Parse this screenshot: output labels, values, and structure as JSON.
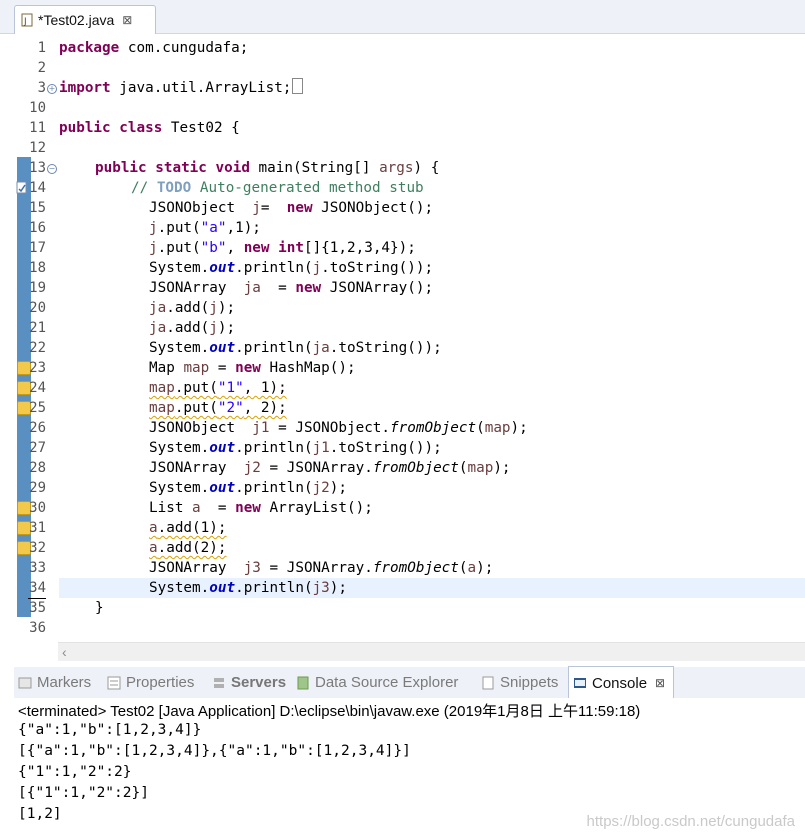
{
  "editor_tab": {
    "title": "*Test02.java",
    "close": "⊠"
  },
  "code_lines": [
    {
      "n": "1"
    },
    {
      "n": "2"
    },
    {
      "n": "3"
    },
    {
      "n": "10"
    },
    {
      "n": "11"
    },
    {
      "n": "12"
    },
    {
      "n": "13"
    },
    {
      "n": "14"
    },
    {
      "n": "15"
    },
    {
      "n": "16"
    },
    {
      "n": "17"
    },
    {
      "n": "18"
    },
    {
      "n": "19"
    },
    {
      "n": "20"
    },
    {
      "n": "21"
    },
    {
      "n": "22"
    },
    {
      "n": "23"
    },
    {
      "n": "24"
    },
    {
      "n": "25"
    },
    {
      "n": "26"
    },
    {
      "n": "27"
    },
    {
      "n": "28"
    },
    {
      "n": "29"
    },
    {
      "n": "30"
    },
    {
      "n": "31"
    },
    {
      "n": "32"
    },
    {
      "n": "33"
    },
    {
      "n": "34"
    },
    {
      "n": "35"
    },
    {
      "n": "36"
    }
  ],
  "code": {
    "l1_kw": "package",
    "l1_rest": " com.cungudafa;",
    "l3_kw": "import",
    "l3_rest": " java.util.ArrayList;",
    "l11_kw1": "public",
    "l11_kw2": "class",
    "l11_rest": " Test02 {",
    "l13_kw": "public static void",
    "l13_rest": " main(String[] ",
    "l13_var": "args",
    "l13_end": ") {",
    "l14_comment": "// ",
    "l14_todo": "TODO",
    "l14_rest": " Auto-generated method stub",
    "l15_a": "JSONObject  ",
    "l15_var": "j",
    "l15_b": "=  ",
    "l15_kw": "new",
    "l15_c": " JSONObject();",
    "l16_a": "j",
    "l16_b": ".put(",
    "l16_str": "\"a\"",
    "l16_c": ",1);",
    "l17_a": "j",
    "l17_b": ".put(",
    "l17_str": "\"b\"",
    "l17_c": ", ",
    "l17_kw1": "new",
    "l17_sp": " ",
    "l17_kw2": "int",
    "l17_d": "[]{1,2,3,4});",
    "l18_a": "System.",
    "l18_fld": "out",
    "l18_b": ".println(",
    "l18_var": "j",
    "l18_c": ".toString());",
    "l19_a": "JSONArray  ",
    "l19_var": "ja",
    "l19_b": "  = ",
    "l19_kw": "new",
    "l19_c": " JSONArray();",
    "l20_var": "ja",
    "l20_b": ".add(",
    "l20_var2": "j",
    "l20_c": ");",
    "l21_var": "ja",
    "l21_b": ".add(",
    "l21_var2": "j",
    "l21_c": ");",
    "l22_a": "System.",
    "l22_fld": "out",
    "l22_b": ".println(",
    "l22_var": "ja",
    "l22_c": ".toString());",
    "l23_a": "Map ",
    "l23_var": "map",
    "l23_b": " = ",
    "l23_kw": "new",
    "l23_c": " HashMap();",
    "l24_var": "map",
    "l24_b": ".put(",
    "l24_str": "\"1\"",
    "l24_c": ", 1);",
    "l25_var": "map",
    "l25_b": ".put(",
    "l25_str": "\"2\"",
    "l25_c": ", 2);",
    "l26_a": "JSONObject  ",
    "l26_var": "j1",
    "l26_b": " = JSONObject.",
    "l26_sm": "fromObject",
    "l26_c": "(",
    "l26_var2": "map",
    "l26_d": ");",
    "l27_a": "System.",
    "l27_fld": "out",
    "l27_b": ".println(",
    "l27_var": "j1",
    "l27_c": ".toString());",
    "l28_a": "JSONArray  ",
    "l28_var": "j2",
    "l28_b": " = JSONArray.",
    "l28_sm": "fromObject",
    "l28_c": "(",
    "l28_var2": "map",
    "l28_d": ");",
    "l29_a": "System.",
    "l29_fld": "out",
    "l29_b": ".println(",
    "l29_var": "j2",
    "l29_c": ");",
    "l30_a": "List ",
    "l30_var": "a",
    "l30_b": "  = ",
    "l30_kw": "new",
    "l30_c": " ArrayList();",
    "l31_var": "a",
    "l31_b": ".add(1);",
    "l32_var": "a",
    "l32_b": ".add(2);",
    "l33_a": "JSONArray  ",
    "l33_var": "j3",
    "l33_b": " = JSONArray.",
    "l33_sm": "fromObject",
    "l33_c": "(",
    "l33_var2": "a",
    "l33_d": ");",
    "l34_a": "System.",
    "l34_fld": "out",
    "l34_b": ".println(",
    "l34_var": "j3",
    "l34_c": ");",
    "l35": "}"
  },
  "views": {
    "markers": "Markers",
    "properties": "Properties",
    "servers": "Servers",
    "datasource": "Data Source Explorer",
    "snippets": "Snippets",
    "console": "Console",
    "console_close": "⊠"
  },
  "console": {
    "status": "<terminated> Test02 [Java Application] D:\\eclipse\\bin\\javaw.exe (2019年1月8日 上午11:59:18)",
    "output": [
      "{\"a\":1,\"b\":[1,2,3,4]}",
      "[{\"a\":1,\"b\":[1,2,3,4]},{\"a\":1,\"b\":[1,2,3,4]}]",
      "{\"1\":1,\"2\":2}",
      "[{\"1\":1,\"2\":2}]",
      "[1,2]"
    ]
  },
  "watermark": "https://blog.csdn.net/cungudafa",
  "colors": {
    "keyword": "#7f0055",
    "string": "#2a00ff",
    "comment": "#3f7f5f",
    "field": "#0000c0",
    "ruler": "#5a8fc2",
    "current_line": "#e8f2fe"
  }
}
